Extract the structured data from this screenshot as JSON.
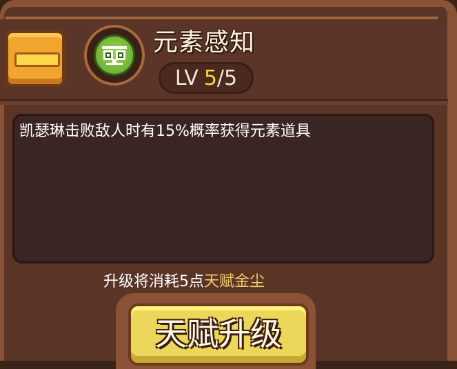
{
  "skill": {
    "title": "元素感知",
    "icon": "owl-eyes-icon",
    "level_prefix": "LV",
    "level_current": "5",
    "level_sep_max": "/5",
    "description": "凯瑟琳击败敌人时有15%概率获得元素道具"
  },
  "cost": {
    "prefix": "升级将消耗5点",
    "currency": "天赋金尘"
  },
  "buttons": {
    "collapse_icon": "minus-icon",
    "upgrade_label": "天赋升级"
  },
  "colors": {
    "panel": "#5a3526",
    "frame": "#8a5236",
    "level_highlight": "#ffd53a",
    "currency_highlight": "#f1cd6a",
    "upgrade_button": "#ecd75a"
  }
}
